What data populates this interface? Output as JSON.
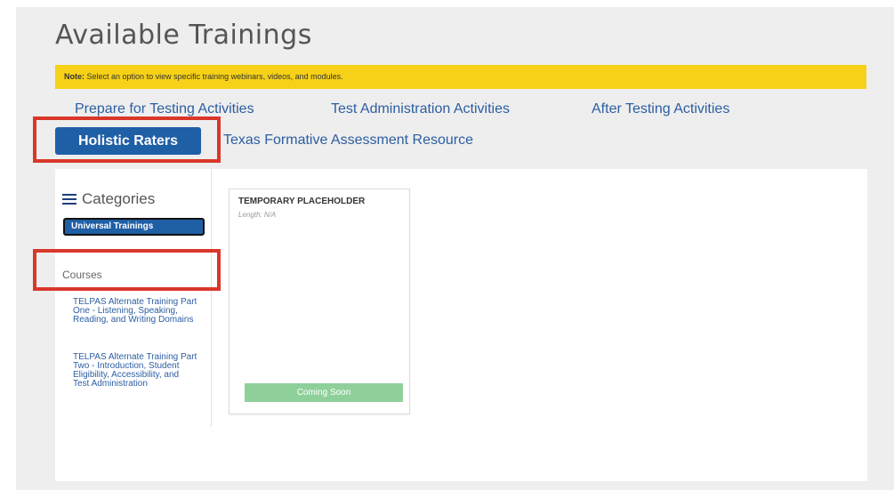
{
  "page": {
    "title": "Available Trainings",
    "note_label": "Note:",
    "note_text": "Select an option to view specific training webinars, videos, and modules."
  },
  "tabs": [
    {
      "label": "Prepare for Testing Activities"
    },
    {
      "label": "Test Administration Activities"
    },
    {
      "label": "After Testing Activities"
    },
    {
      "label": "Holistic Raters",
      "active": true
    },
    {
      "label": "Texas Formative Assessment Resource"
    }
  ],
  "sidebar": {
    "categories_heading": "Categories",
    "category_selected": "Universal Trainings",
    "courses_heading": "Courses",
    "courses": [
      "TELPAS Alternate Training Part One - Listening, Speaking, Reading, and Writing Domains",
      "TELPAS Alternate Training Part Two - Introduction, Student Eligibility, Accessibility, and Test Administration"
    ]
  },
  "card": {
    "title": "TEMPORARY PLACEHOLDER",
    "length": "Length: N/A",
    "button_label": "Coming Soon"
  },
  "colors": {
    "accent": "#1f5fa6",
    "note_bg": "#f7d117",
    "highlight_border": "#d9372a",
    "coming_soon": "#8fd09a"
  }
}
